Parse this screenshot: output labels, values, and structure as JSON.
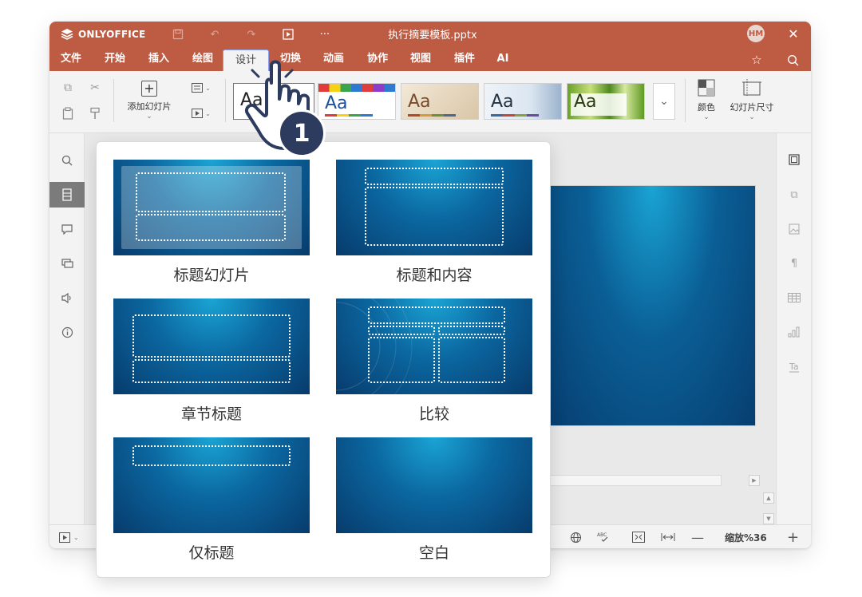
{
  "app": {
    "logo_text": "ONLYOFFICE",
    "doc_title": "执行摘要模板.pptx",
    "user_initials": "HM"
  },
  "menu": {
    "items": [
      "文件",
      "开始",
      "插入",
      "绘图",
      "设计",
      "切换",
      "动画",
      "协作",
      "视图",
      "插件",
      "AI"
    ],
    "active": "设计"
  },
  "ribbon": {
    "add_slide": "添加幻灯片",
    "color": "颜色",
    "slide_size": "幻灯片尺寸",
    "theme_sample": "Aa"
  },
  "layouts": [
    {
      "label": "标题幻灯片"
    },
    {
      "label": "标题和内容"
    },
    {
      "label": "章节标题"
    },
    {
      "label": "比较"
    },
    {
      "label": "仅标题"
    },
    {
      "label": "空白"
    }
  ],
  "status": {
    "zoom": "缩放%36"
  },
  "step_badge": "1",
  "colors": {
    "titlebar": "#be5b43",
    "badge": "#2c3b5e",
    "slide_dark": "#073e70",
    "slide_light": "#1aa4d4"
  }
}
